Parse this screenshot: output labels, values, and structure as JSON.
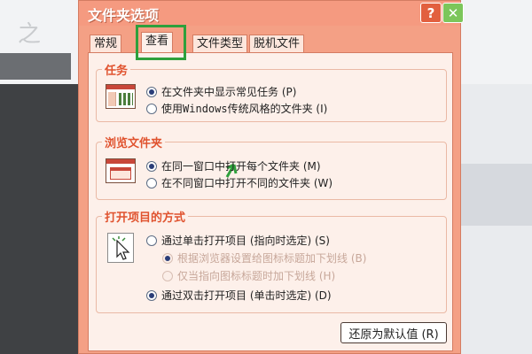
{
  "dialog": {
    "title": "文件夹选项",
    "help_label": "?",
    "close_label": "✕"
  },
  "tabs": [
    {
      "label": "常规"
    },
    {
      "label": "查看"
    },
    {
      "label": "文件类型"
    },
    {
      "label": "脱机文件"
    }
  ],
  "tasks": {
    "title": "任务",
    "options": [
      {
        "label": "在文件夹中显示常见任务 (P)",
        "checked": true
      },
      {
        "label_prefix": "使用 ",
        "label_mono": "Windows",
        "label_suffix": " 传统风格的文件夹 (I)",
        "checked": false
      }
    ]
  },
  "browse": {
    "title": "浏览文件夹",
    "options": [
      {
        "label": "在同一窗口中打开每个文件夹 (M)",
        "checked": true
      },
      {
        "label": "在不同窗口中打开不同的文件夹 (W)",
        "checked": false
      }
    ]
  },
  "open_items": {
    "title": "打开项目的方式",
    "options": [
      {
        "label": "通过单击打开项目 (指向时选定) (S)",
        "checked": false,
        "enabled": true
      },
      {
        "label": "根据浏览器设置给图标标题加下划线 (B)",
        "checked": true,
        "enabled": false
      },
      {
        "label": "仅当指向图标标题时加下划线 (H)",
        "checked": false,
        "enabled": false
      },
      {
        "label": "通过双击打开项目 (单击时选定) (D)",
        "checked": true,
        "enabled": true
      }
    ]
  },
  "buttons": {
    "restore_defaults": "还原为默认值 (R)"
  },
  "colors": {
    "accent": "#f59a80",
    "highlight": "#2ea03c",
    "group_title": "#e0532f"
  }
}
